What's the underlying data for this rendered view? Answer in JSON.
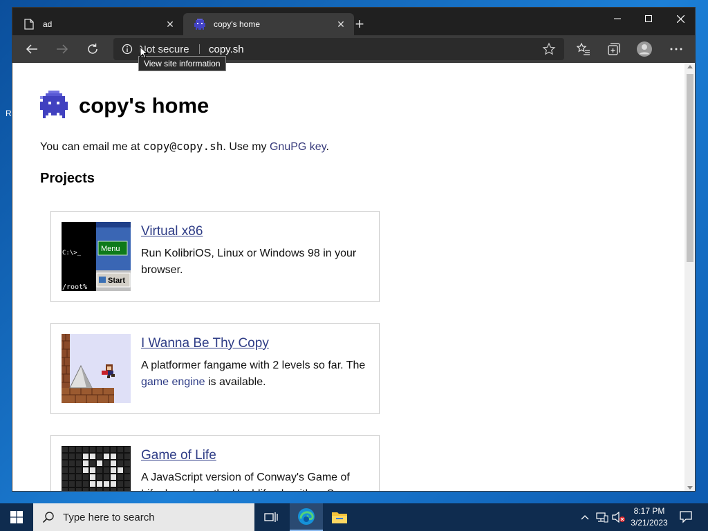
{
  "desktop": {
    "edge_letter": "R"
  },
  "browser": {
    "tabs": [
      {
        "title": "ad",
        "icon": "page-icon"
      },
      {
        "title": "copy's home",
        "icon": "copy-ghost-icon"
      }
    ],
    "address": {
      "security_text": "Not secure",
      "url": "copy.sh"
    },
    "tooltip": "View site information"
  },
  "page": {
    "title": "copy's home",
    "intro": {
      "prefix": "You can email me at ",
      "email": "copy@copy.sh",
      "middle": ". Use my ",
      "link": "GnuPG key",
      "suffix": "."
    },
    "projects_heading": "Projects",
    "projects": [
      {
        "title": "Virtual x86",
        "desc": "Run KolibriOS, Linux or Windows 98 in your browser.",
        "thumb": {
          "prompt": "C:\\>_",
          "root": "/root%",
          "menu": "Menu",
          "start": "Start"
        }
      },
      {
        "title": "I Wanna Be Thy Copy",
        "desc_prefix": "A platformer fangame with 2 levels so far. The ",
        "desc_link": "game engine",
        "desc_suffix": " is available."
      },
      {
        "title": "Game of Life",
        "desc": "A JavaScript version of Conway's Game of Life, based on the Hashlife algorithm. Source"
      }
    ]
  },
  "taskbar": {
    "search_placeholder": "Type here to search",
    "time": "8:17 PM",
    "date": "3/21/2023"
  },
  "colors": {
    "link": "#2e3c86",
    "titlebar": "#202020",
    "toolbar": "#3b3b3b",
    "taskbar": "#0f2c4f"
  }
}
